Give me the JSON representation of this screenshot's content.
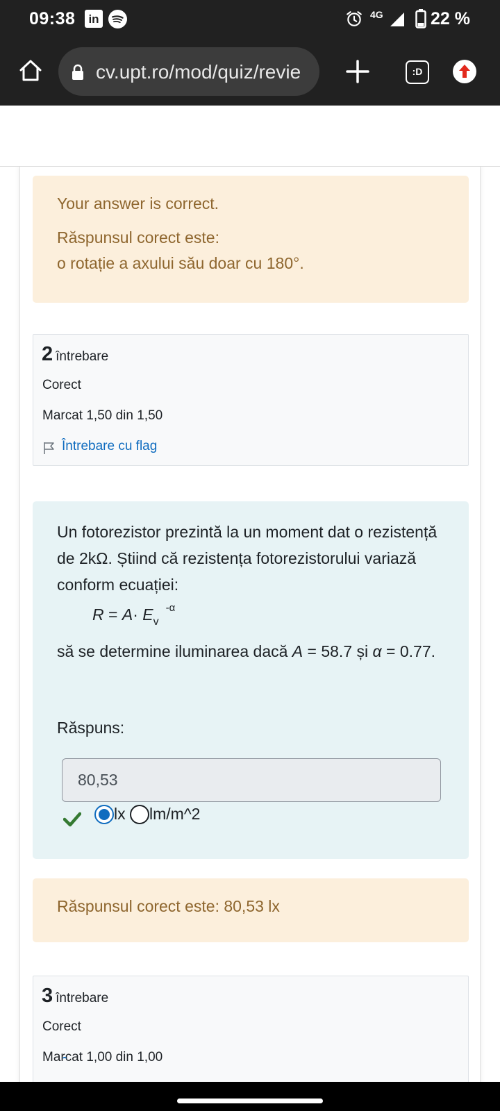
{
  "status_bar": {
    "time": "09:38",
    "linkedin_icon": "in",
    "network": "4G",
    "battery": "22 %"
  },
  "browser": {
    "url": "cv.upt.ro/mod/quiz/revie",
    "tabs_label": ":D"
  },
  "feedback_q1": {
    "status": "Your answer is correct.",
    "correct_label": "Răspunsul corect este:",
    "correct_answer": "o rotație a axului său doar cu 180°."
  },
  "question2": {
    "number": "2",
    "word": "întrebare",
    "state": "Corect",
    "grade": "Marcat 1,50 din 1,50",
    "flag_label": "Întrebare cu flag",
    "text_intro": "Un fotorezistor prezintă la un moment dat o rezistență de 2kΩ. Știind că rezistența fotorezistorului variază conform ecuației:",
    "formula": {
      "r": "R",
      "eq": " = ",
      "a": "A",
      "dot": "· ",
      "e": "E",
      "sub": "v",
      "sup": "-α"
    },
    "text_after_1": "să se determine iluminarea dacă ",
    "var_a": "A",
    "text_after_2": " = 58.7 și ",
    "var_alpha": "α",
    "text_after_3": " = 0.77.",
    "answer_label": "Răspuns:",
    "answer_value": "80,53",
    "unit_options": [
      "lx",
      "lm/m^2"
    ],
    "selected_unit": "lx"
  },
  "feedback_q2": {
    "correct_answer": "Răspunsul corect este: 80,53 lx"
  },
  "question3": {
    "number": "3",
    "word": "întrebare",
    "state": "Corect",
    "grade": "Marcat 1,00 din 1,00"
  },
  "colors": {
    "feedback_bg": "#fcefdc",
    "feedback_text": "#8e662e",
    "question_bg": "#e7f3f5",
    "link": "#0f6cbf",
    "correct_check": "#357a32",
    "topbar": "#212121"
  },
  "icons": [
    "linkedin-icon",
    "spotify-icon",
    "alarm-icon",
    "signal-icon",
    "battery-icon",
    "home-icon",
    "lock-icon",
    "plus-icon",
    "tabs-icon",
    "update-icon",
    "flag-icon",
    "check-icon"
  ]
}
